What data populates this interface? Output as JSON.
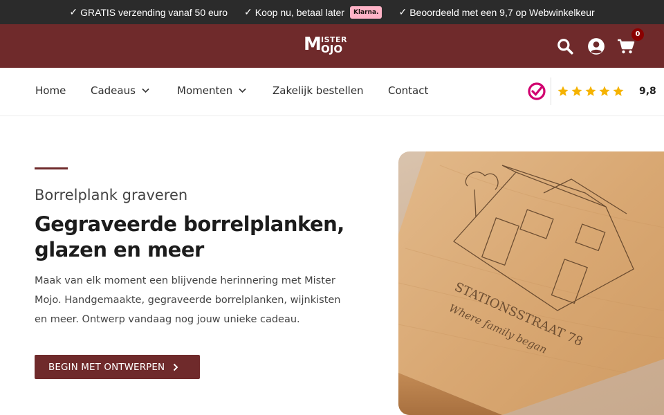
{
  "topbar": {
    "usps": [
      {
        "text": "GRATIS verzending vanaf 50 euro"
      },
      {
        "text": "Koop nu, betaal later",
        "badge": "Klarna."
      },
      {
        "text": "Beoordeeld met een 9,7 op Webwinkelkeur"
      }
    ],
    "check_glyph": "✓"
  },
  "header": {
    "logo": {
      "line1": "M",
      "line2": "ISTER",
      "line3": "OJO"
    },
    "icons": [
      "search-icon",
      "user-icon",
      "cart-icon"
    ],
    "cart_count": "0",
    "background": "#6f2a2b"
  },
  "nav": {
    "items": [
      {
        "label": "Home",
        "has_dropdown": false
      },
      {
        "label": "Cadeaus",
        "has_dropdown": true
      },
      {
        "label": "Momenten",
        "has_dropdown": true
      },
      {
        "label": "Zakelijk bestellen",
        "has_dropdown": false
      },
      {
        "label": "Contact",
        "has_dropdown": false
      }
    ],
    "rating": {
      "stars": 5,
      "score": "9,8",
      "star_color": "#f5b301",
      "logo_icon": "webwinkelkeur-icon"
    }
  },
  "hero": {
    "subtitle": "Borrelplank graveren",
    "headline_lines": [
      "Gegraveerde borrelplanken,",
      "glazen en meer"
    ],
    "intro_lines": [
      "Maak van elk moment een blijvende herinnering met Mister",
      "Mojo. Handgemaakte, gegraveerde borrelplanken, wijnkisten",
      "en meer. Ontwerp vandaag nog jouw unieke cadeau."
    ],
    "cta_label": "BEGIN MET ONTWERPEN",
    "image": {
      "engraving_line1": "STATIONSSTRAAT 78",
      "engraving_line2": "Where family began"
    }
  },
  "colors": {
    "brand": "#6f2a2b",
    "topbar": "#2b2b2b",
    "klarna": "#ffb3c7"
  }
}
